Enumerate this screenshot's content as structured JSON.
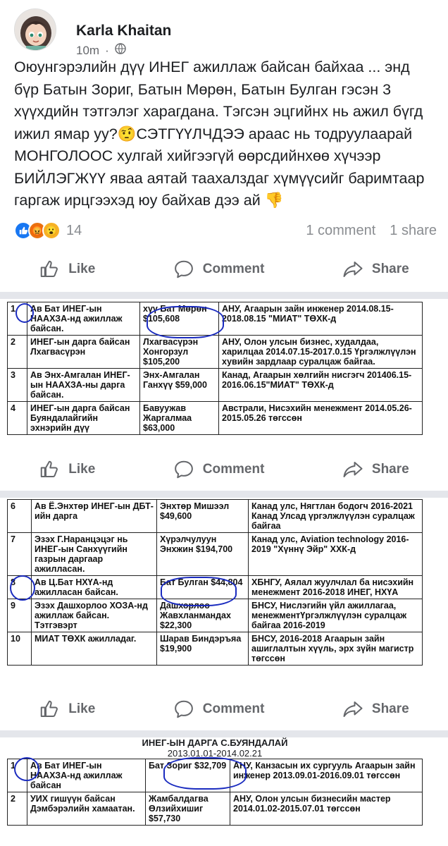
{
  "post": {
    "author": "Karla Khaitan",
    "time": "10m",
    "separator": "·",
    "text": "Оюунгэрэлийн дүү ИНЕГ ажиллаж байсан байхаа ... энд бүр  Батын Зориг, Батын Мөрөн, Батын Булган гэсэн 3 хүүхдийн тэтгэлэг харагдана. Тэгсэн эцгийнх нь ажил бүгд ижил ямар уу?🤨СЭТГҮҮЛЧДЭЭ араас нь тодруулаарай МОНГОЛООС хулгай хийгээгүй өөрсдийнхөө хүчээр БИЙЛЭГЖҮҮ яваа аятай таахалздаг хүмүүсийг баримтаар гаргаж ирцгээхэд юу байхав дээ ай 👎"
  },
  "stats": {
    "reaction_count": "14",
    "comments": "1 comment",
    "shares": "1 share"
  },
  "actions": {
    "like": "Like",
    "comment": "Comment",
    "share": "Share"
  },
  "doc1": {
    "rows": [
      {
        "n": "1",
        "a": "Ав    Бат      ИНЕГ-ын НААХЗА-нд   ажиллаж байсан.",
        "b": "хүү Бат Мөрөн $105,608",
        "c": "АНУ, Агаарын зайн инженер 2014.08.15-2018.08.15 \"МИАТ\" ТӨХК-д"
      },
      {
        "n": "2",
        "a": "ИНЕГ-ын дарга байсан Лхагвасүрэн",
        "b": "Лхагвасүрэн Хонгорзул $105,200",
        "c": "АНУ, Олон улсын бизнес, худалдаа, харилцаа 2014.07.15-2017.0.15 Үргэлжлүүлэн хувийн зардлаар суралцаж байгаа."
      },
      {
        "n": "3",
        "a": "Ав Энх-Амгалан ИНЕГ-ын НААХЗА-ны дарга байсан.",
        "b": "Энх-Амгалан Ганхүү $59,000",
        "c": "Канад, Агаарын хөлгийн нисгэгч 201406.15-2016.06.15\"МИАТ\" ТӨХК-д"
      },
      {
        "n": "4",
        "a": "ИНЕГ-ын дарга байсан Буяндалайгийн эхнэрийн дүү",
        "b": "Бавуужав Жаргалмаа $63,000",
        "c": "Австрали, Нисэхийн менежмент 2014.05.26-2015.05.26 төгссөн"
      }
    ]
  },
  "doc2": {
    "rows": [
      {
        "n": "6",
        "a": "Ав Ё.Энхтөр ИНЕГ-ын ДБТ-ийн дарга",
        "b": "Энхтөр Мишээл $49,600",
        "c": "Канад улс, Нягтлан бодогч 2016-2021 Канад Улсад үргэлжлүүлэн суралцаж байгаа"
      },
      {
        "n": "7",
        "a": "Эзэх Г.Наранцэцэг нь ИНЕГ-ын Санхүүгийн газрын даргаар ажилласан.",
        "b": "Хүрэлчулуун Энхжин $194,700",
        "c": "Канад улс, Aviation technology 2016-2019 \"Хүннү Эйр\" ХХК-д"
      },
      {
        "n": "8",
        "a": "Ав    Ц.Бат    НХҮА-нд ажилласан байсан.",
        "b": "Бат Булган $44,804",
        "c": "ХБНГУ, Аялал жуулчлал ба нисэхийн менежмент 2016-2018 ИНЕГ, НХҮА"
      },
      {
        "n": "9",
        "a": "Эзэх Дашхорлоо ХОЗА-нд ажиллаж байсан. Тэтгэвэрт",
        "b": "Дашхорлоо Жавхланмандах $22,300",
        "c": "БНСУ, Нислэгийн үйл ажиллагаа, менежментҮргэлжлүүлэн суралцаж байгаа 2016-2019"
      },
      {
        "n": "10",
        "a": "МИАТ ТӨХК ажилладаг.",
        "b": "Шарав Биндэръяа $19,900",
        "c": "БНСУ, 2016-2018 Агаарын зайн ашиглалтын хүүль, эрх зүйн магистр төгссөн"
      }
    ]
  },
  "doc3": {
    "title": "ИНЕГ-ЫН ДАРГА С.БУЯНДАЛАЙ",
    "subtitle": "2013.01.01-2014.02.21",
    "rows": [
      {
        "n": "1",
        "a": "Ав    Бат    ИНЕГ-ын НААХЗА-нд   ажиллаж байсан",
        "b": "Бат Зориг $32,709",
        "c": "АНУ, Канзасын их сургууль Агаарын зайн инженер 2013.09.01-2016.09.01 төгссөн"
      },
      {
        "n": "2",
        "a": "УИХ   гишүүн   байсан Дэмбэрэлийн хамаатан.",
        "b": "Жамбалдагва Өлзийхишиг $57,730",
        "c": "АНУ, Олон улсын бизнесийн мастер 2014.01.02-2015.07.01 төгссөн"
      }
    ]
  },
  "colors": {
    "text": "#1c1e21",
    "secondary": "#65676b",
    "separator": "#e4e6eb",
    "ink_circle": "#1a2bbf",
    "like_blue": "#1877f2"
  }
}
